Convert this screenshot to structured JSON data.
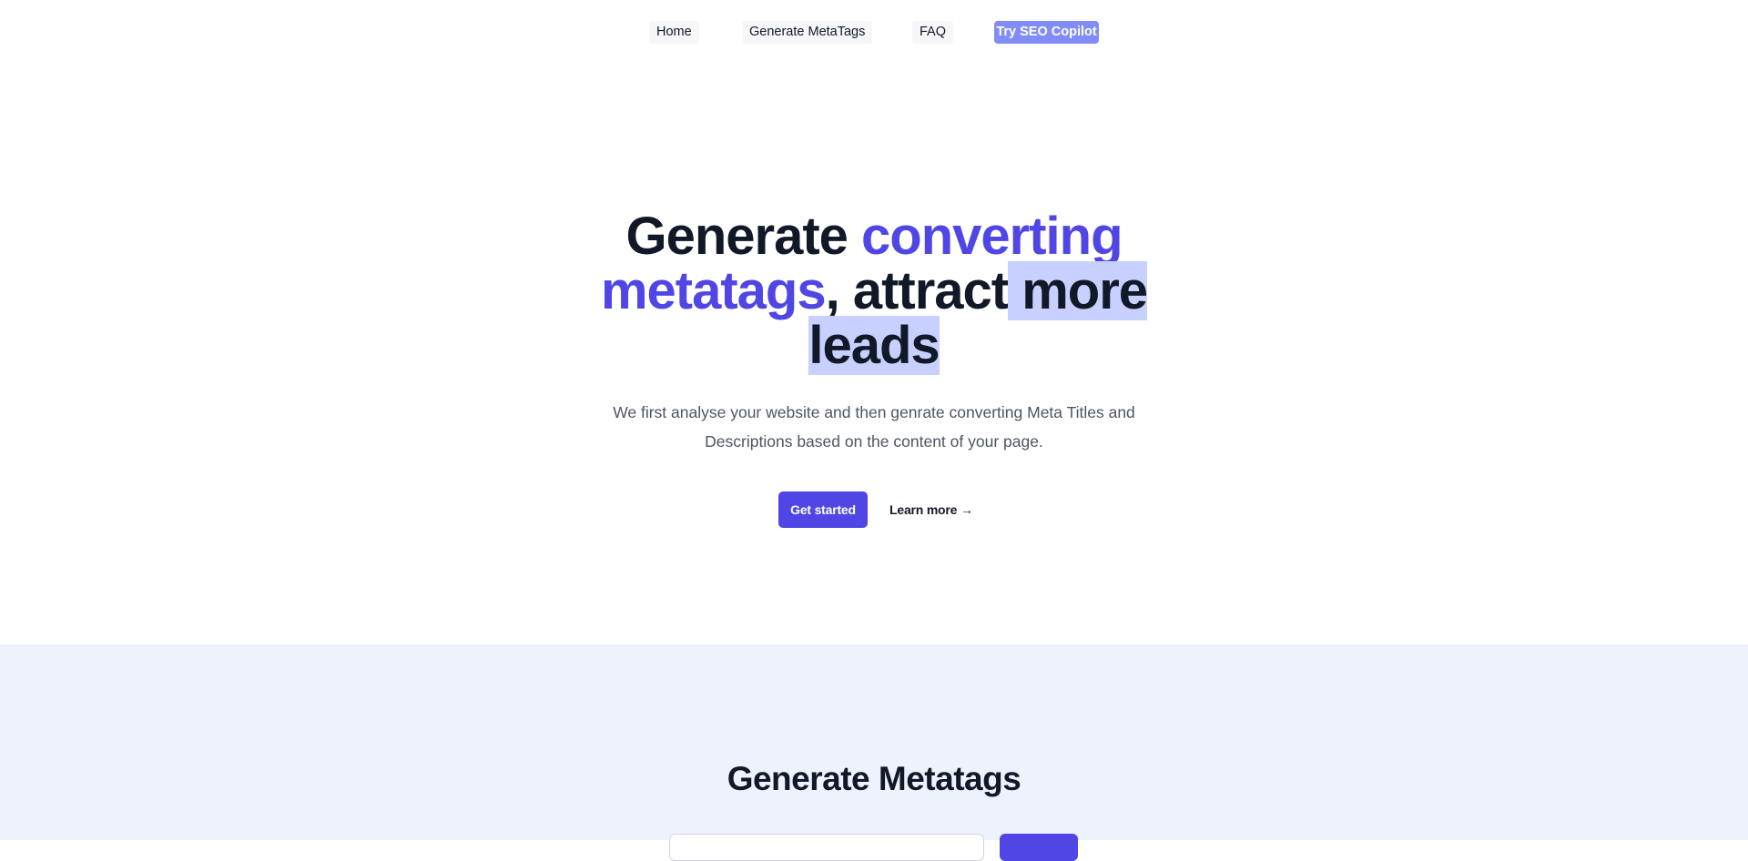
{
  "nav": {
    "home": "Home",
    "generate": "Generate MetaTags",
    "faq": "FAQ",
    "cta": "Try SEO Copilot"
  },
  "hero": {
    "title_part1": "Generate ",
    "title_accent": "converting metatags",
    "title_part2": ", attract",
    "title_part3": " more leads",
    "subtitle": "We first analyse your website and then genrate converting Meta Titles and Descriptions based on the content of your page.",
    "primary_button": "Get started",
    "secondary_link": "Learn more →"
  },
  "generator": {
    "title": "Generate Metatags",
    "input_value": "",
    "input_placeholder": "",
    "submit_label": ""
  },
  "colors": {
    "accent": "#4f46e5",
    "nav_cta": "#818cf8",
    "section_bg": "#eef2fd",
    "selection": "#c7d0ff"
  }
}
